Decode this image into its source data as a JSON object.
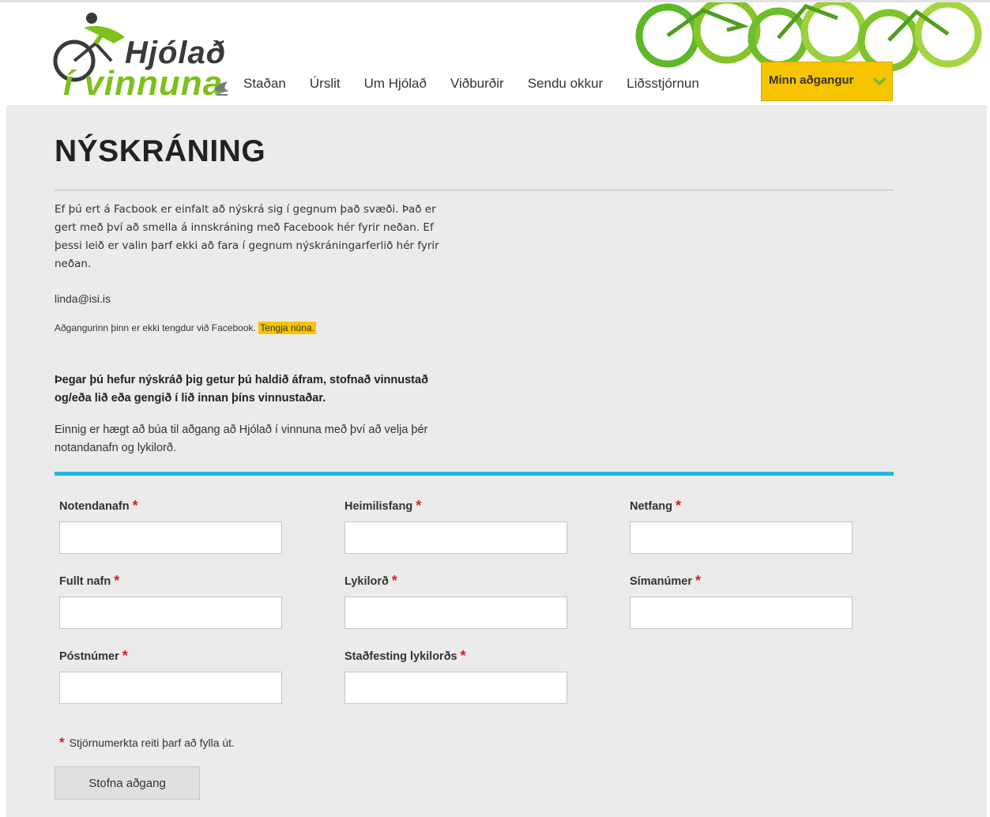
{
  "logo": {
    "line1": "Hjólað",
    "line2": "í vinnuna"
  },
  "nav": {
    "items": [
      "Staðan",
      "Úrslit",
      "Um Hjólað",
      "Viðburðir",
      "Sendu okkur",
      "Liðsstjórnun"
    ],
    "account_label": "Minn aðgangur"
  },
  "page": {
    "title": "NÝSKRÁNING",
    "intro": "Ef þú ert á Facbook er einfalt að nýskrá sig í gegnum það svæði. Það er gert með því að smella á innskráning með Facebook hér fyrir neðan. Ef þessi leið er valin þarf ekki að fara í gegnum nýskráningarferlið hér fyrir neðan.",
    "email": "linda@isi.is",
    "fb_status": "Aðgangurinn þinn er ekki tengdur við Facebook.",
    "fb_connect": "Tengja núna.",
    "after_text": "Þegar þú hefur nýskráð þig getur þú haldið áfram, stofnað vinnustað og/eða lið eða gengið í lið innan þíns vinnustaðar.",
    "alt_text": "Einnig er hægt að búa til aðgang að Hjólað í vinnuna með því að velja þér notandanafn og lykilorð."
  },
  "form": {
    "required_mark": "*",
    "fields": [
      {
        "label": "Notendanafn",
        "value": ""
      },
      {
        "label": "Heimilisfang",
        "value": ""
      },
      {
        "label": "Netfang",
        "value": ""
      },
      {
        "label": "Fullt nafn",
        "value": ""
      },
      {
        "label": "Lykilorð",
        "value": ""
      },
      {
        "label": "Símanúmer",
        "value": ""
      },
      {
        "label": "Póstnúmer",
        "value": ""
      },
      {
        "label": "Staðfesting lykilorðs",
        "value": ""
      }
    ],
    "required_note": "Stjörnumerkta reiti þarf að fylla út.",
    "submit_label": "Stofna aðgang"
  },
  "colors": {
    "accent": "#f7c400",
    "brand_green": "#7cc11c",
    "divider_blue": "#20b8e6",
    "required": "#d0202a"
  }
}
